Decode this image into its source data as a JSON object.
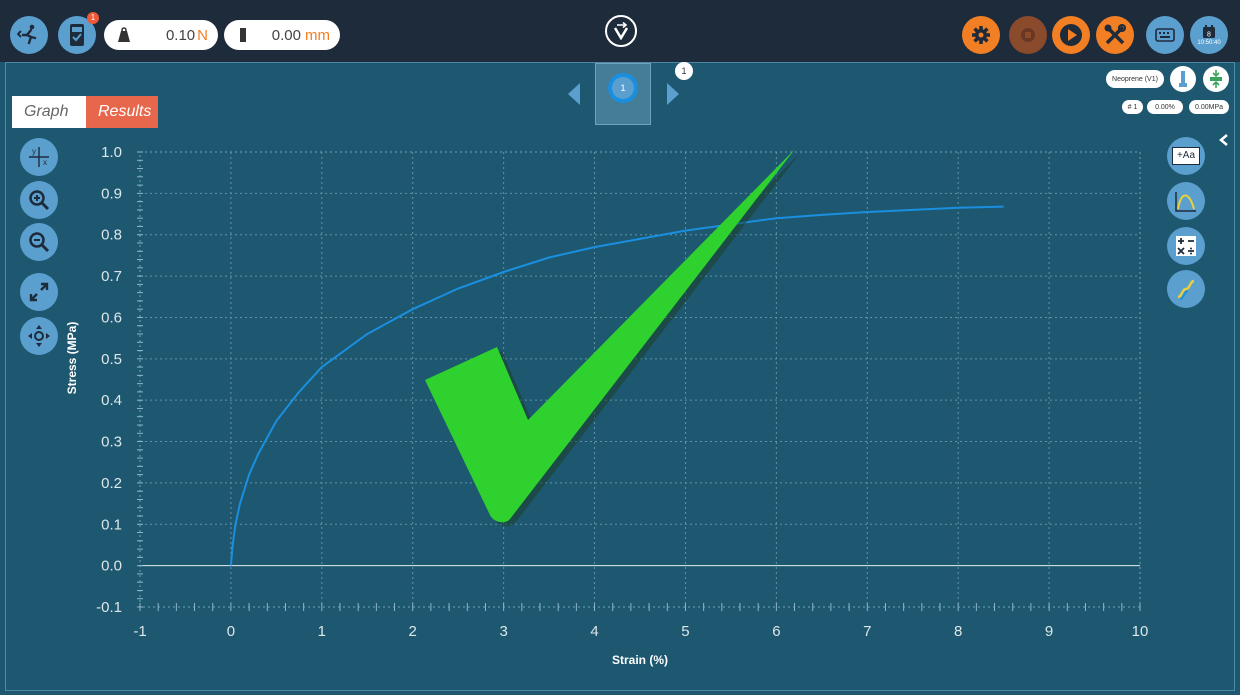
{
  "toolbar": {
    "force_value": "0.10",
    "force_unit": "N",
    "position_value": "0.00",
    "position_unit": "mm",
    "notification_count": "1",
    "clock_day": "8",
    "clock_time": "10:50:40"
  },
  "icons": {
    "exit": "running-person-exit-icon",
    "device": "tablet-check-icon",
    "weight": "weight-icon",
    "ruler": "ruler-icon",
    "logo": "v-logo-icon",
    "settings": "gear-icon",
    "stop": "stop-icon",
    "play": "play-icon",
    "tools": "tools-icon",
    "keyboard": "keyboard-icon",
    "calendar": "calendar-icon"
  },
  "colors": {
    "background": "#1d5870",
    "topbar": "#1e2b3b",
    "accent_blue": "#5b9fcf",
    "accent_orange": "#f27f24",
    "results_tab": "#e7674d",
    "curve": "#1a8fe0",
    "checkmark": "#2ed12e"
  },
  "nav": {
    "current_sample": "1",
    "sample_badge": "1"
  },
  "test_info": {
    "material": "Neoprene (V1)",
    "sample_number": "# 1",
    "strain": "0.00%",
    "stress": "0.00MPa"
  },
  "tabs": {
    "graph": "Graph",
    "results": "Results"
  },
  "right_tools": {
    "annotate_label": "+Aa"
  },
  "chart_data": {
    "type": "line",
    "xlabel": "Strain (%)",
    "ylabel": "Stress (MPa)",
    "xlim": [
      -1,
      10
    ],
    "ylim": [
      -0.1,
      1.0
    ],
    "x_ticks": [
      "-1",
      "0",
      "1",
      "2",
      "3",
      "4",
      "5",
      "6",
      "7",
      "8",
      "9",
      "10"
    ],
    "y_ticks": [
      "1.0",
      "0.9",
      "0.8",
      "0.7",
      "0.6",
      "0.5",
      "0.4",
      "0.3",
      "0.2",
      "0.1",
      "0.0",
      "-0.1"
    ],
    "grid": true,
    "series": [
      {
        "x": [
          0,
          0.02,
          0.05,
          0.1,
          0.2,
          0.3,
          0.5,
          0.75,
          1.0,
          1.5,
          2.0,
          2.5,
          3.0,
          3.5,
          4.0,
          4.5,
          5.0,
          5.5,
          6.0,
          6.5,
          7.0,
          7.5,
          8.0,
          8.5
        ],
        "y": [
          0.0,
          0.05,
          0.1,
          0.15,
          0.22,
          0.27,
          0.35,
          0.42,
          0.48,
          0.56,
          0.62,
          0.67,
          0.71,
          0.745,
          0.77,
          0.79,
          0.81,
          0.825,
          0.84,
          0.848,
          0.855,
          0.86,
          0.865,
          0.868
        ]
      }
    ]
  }
}
